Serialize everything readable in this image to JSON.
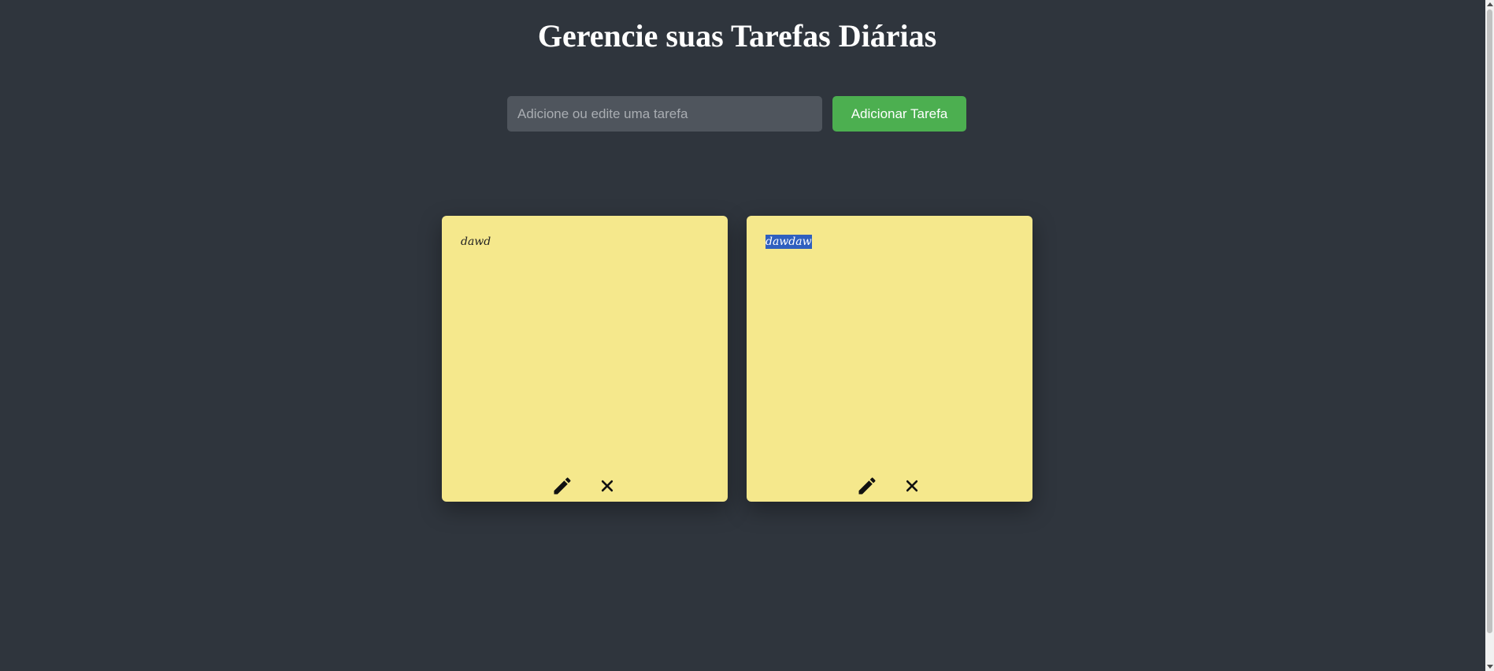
{
  "header": {
    "title": "Gerencie suas Tarefas Diárias"
  },
  "task_form": {
    "input_value": "",
    "input_placeholder": "Adicione ou edite uma tarefa",
    "add_button_label": "Adicionar Tarefa"
  },
  "notes": [
    {
      "text": "dawd",
      "selected": false
    },
    {
      "text": "dawdaw",
      "selected": true
    }
  ],
  "icons": {
    "edit": "pencil-icon",
    "delete": "close-icon"
  },
  "colors": {
    "background": "#2f353d",
    "note": "#f5e88c",
    "button": "#4caf50",
    "input": "#4f555d"
  }
}
